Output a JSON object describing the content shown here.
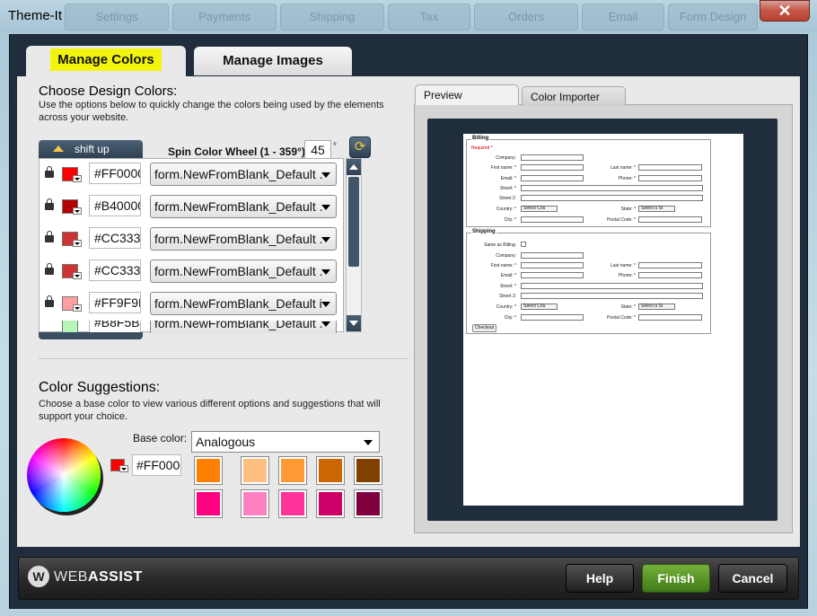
{
  "window": {
    "title": "Theme-It",
    "close_label": "✕",
    "background_tabs": [
      "Settings",
      "Payments",
      "Shipping",
      "Tax",
      "Orders",
      "Email",
      "Form Design"
    ]
  },
  "tabs": {
    "active": "Manage Colors",
    "inactive": "Manage Images"
  },
  "design_colors": {
    "heading": "Choose Design Colors:",
    "description_line1": "Use the options below to quickly change the colors being used by the elements",
    "description_line2": "across your website.",
    "shift_up_label": "shift up",
    "spin_label": "Spin Color Wheel (1 - 359°):",
    "spin_value": "45",
    "spin_unit": "°",
    "rows": [
      {
        "color": "#ff0000",
        "hex": "#FF0000",
        "element": "form.NewFromBlank_Default ."
      },
      {
        "color": "#b40000",
        "hex": "#B40000",
        "element": "form.NewFromBlank_Default ."
      },
      {
        "color": "#cc3333",
        "hex": "#CC3333",
        "element": "form.NewFromBlank_Default ."
      },
      {
        "color": "#cc3333",
        "hex": "#CC3333",
        "element": "form.NewFromBlank_Default ."
      },
      {
        "color": "#ff9f9f",
        "hex": "#FF9F9F",
        "element": "form.NewFromBlank_Default i"
      },
      {
        "color": "#b8f5b8",
        "hex": "#B8F5B",
        "element": "form.NewFromBlank_Default ."
      }
    ]
  },
  "suggestions": {
    "heading": "Color Suggestions:",
    "description_line1": "Choose a base color to view various different options and suggestions that will",
    "description_line2": "support your choice.",
    "base_label": "Base color:",
    "scheme": "Analogous",
    "base_hex": "#FF0000",
    "swatches_row1": [
      "#ff8000",
      "#ffbf80",
      "#ff9933",
      "#cc6600",
      "#804000"
    ],
    "swatches_row2": [
      "#ff0080",
      "#ff80c0",
      "#ff3399",
      "#cc0066",
      "#800040"
    ]
  },
  "preview": {
    "tab_active": "Preview",
    "tab_inactive": "Color Importer",
    "billing": {
      "legend": "Billing",
      "required": "Required *",
      "company": "Company:",
      "first_name": "First name: *",
      "last_name": "Last name: *",
      "email": "Email: *",
      "phone": "Phone: *",
      "street": "Street: *",
      "street2": "Street 2:",
      "country": "Country: *",
      "country_value": "Select Cou",
      "state": "State: *",
      "state_value": "Select a St",
      "city": "City: *",
      "postal": "Postal Code: *"
    },
    "shipping": {
      "legend": "Shipping",
      "same_as_billing": "Same as Billing:",
      "company": "Company:",
      "first_name": "First name: *",
      "last_name": "Last name: *",
      "email": "Email: *",
      "phone": "Phone: *",
      "street": "Street: *",
      "street2": "Street 2:",
      "country": "Country: *",
      "country_value": "Select Cou",
      "state": "State: *",
      "state_value": "Select a St",
      "city": "City: *",
      "postal": "Postal Code: *",
      "checkout": "Checkout"
    }
  },
  "footer": {
    "logo_letter": "W",
    "brand_light": "WEB",
    "brand_bold": "ASSIST",
    "help": "Help",
    "finish": "Finish",
    "cancel": "Cancel"
  }
}
